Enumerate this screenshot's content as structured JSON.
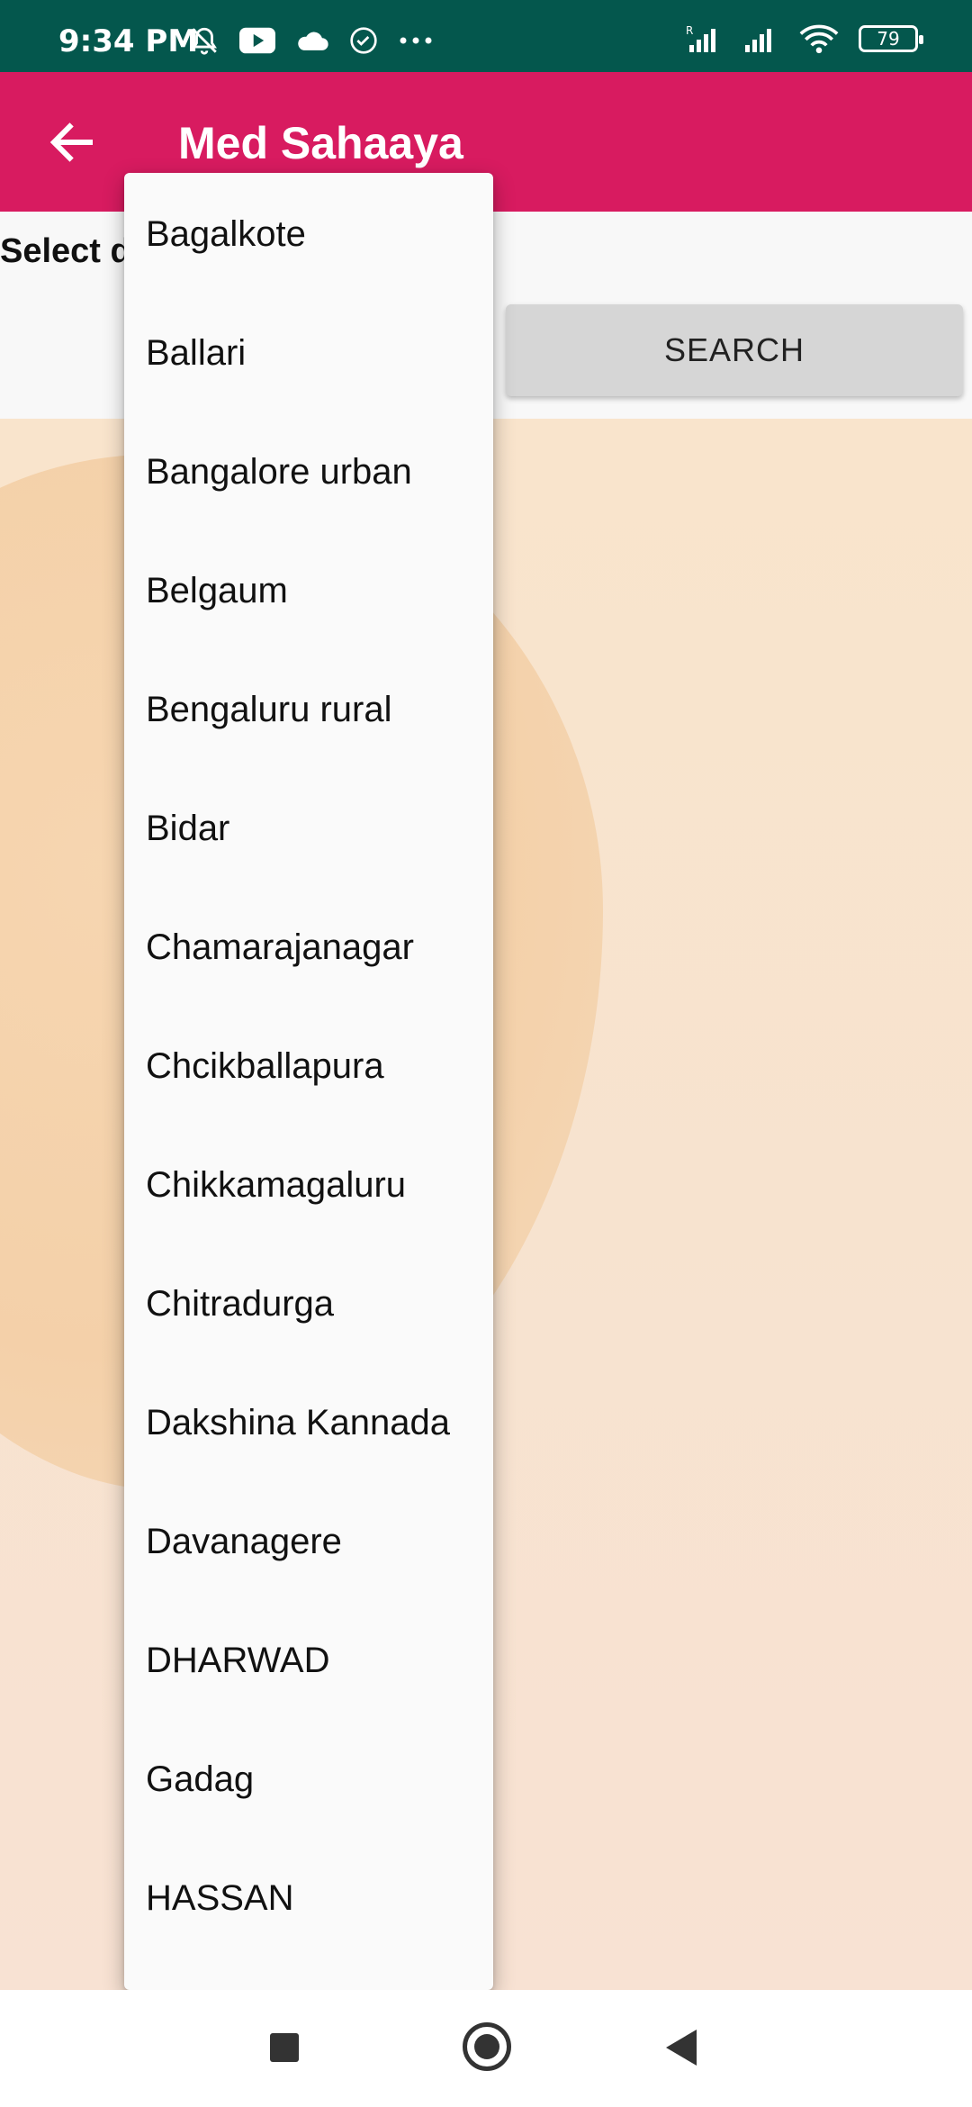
{
  "status_bar": {
    "time": "9:34 PM",
    "battery": "79",
    "icons_left": [
      "bell-off-icon",
      "youtube-icon",
      "cloud-icon",
      "check-circle-icon",
      "more-dots-icon"
    ],
    "icons_right": [
      "signal-roaming-icon",
      "signal-icon",
      "wifi-icon",
      "battery-icon"
    ]
  },
  "app_bar": {
    "title": "Med Sahaaya",
    "back_icon": "arrow-back-icon",
    "color": "#d81b60"
  },
  "main": {
    "select_label": "Select district from below",
    "search_label": "SEARCH"
  },
  "dropdown": {
    "items": [
      "Bagalkote",
      "Ballari",
      "Bangalore urban",
      "Belgaum",
      "Bengaluru rural",
      "Bidar",
      "Chamarajanagar",
      "Chcikballapura",
      "Chikkamagaluru",
      "Chitradurga",
      "Dakshina Kannada",
      "Davanagere",
      "DHARWAD",
      "Gadag",
      "HASSAN"
    ]
  },
  "nav_bar": {
    "icons": [
      "recents-square-icon",
      "home-circle-icon",
      "back-triangle-icon"
    ]
  }
}
